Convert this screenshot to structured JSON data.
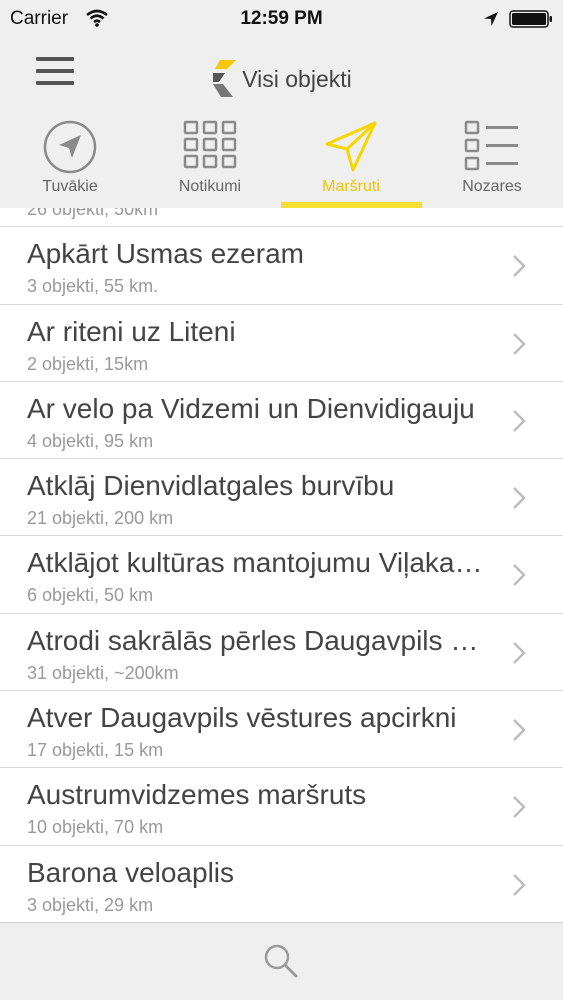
{
  "status_bar": {
    "carrier": "Carrier",
    "time": "12:59 PM",
    "wifi_icon": "wifi-icon",
    "location_icon": "location-arrow-icon",
    "battery_icon": "battery-full-icon"
  },
  "nav": {
    "title": "Visi objekti",
    "menu_icon": "hamburger-menu-icon",
    "logo_icon": "app-logo-icon"
  },
  "tabs": [
    {
      "label": "Tuvākie",
      "icon": "compass-arrow-icon",
      "active": false
    },
    {
      "label": "Notikumi",
      "icon": "grid-icon",
      "active": false
    },
    {
      "label": "Maršruti",
      "icon": "paper-plane-icon",
      "active": true
    },
    {
      "label": "Nozares",
      "icon": "list-icon",
      "active": false
    }
  ],
  "routes": {
    "partial_row_subtitle": "26 objekti, 50km",
    "items": [
      {
        "title": "Apkārt Usmas ezeram",
        "subtitle": "3 objekti, 55 km."
      },
      {
        "title": "Ar riteni uz Liteni",
        "subtitle": "2 objekti, 15km"
      },
      {
        "title": "Ar velo pa Vidzemi un Dienvidigauju",
        "subtitle": "4 objekti, 95 km"
      },
      {
        "title": "Atklāj Dienvidlatgales burvību",
        "subtitle": "21 objekti, 200 km"
      },
      {
        "title": "Atklājot kultūras mantojumu Viļakas novadā",
        "subtitle": "6 objekti, 50 km"
      },
      {
        "title": "Atrodi sakrālās pērles Daugavpils novadā",
        "subtitle": "31 objekti, ~200km"
      },
      {
        "title": "Atver Daugavpils vēstures apcirkni",
        "subtitle": "17 objekti, 15 km"
      },
      {
        "title": "Austrumvidzemes maršruts",
        "subtitle": "10 objekti, 70 km"
      },
      {
        "title": "Barona veloaplis",
        "subtitle": "3 objekti, 29 km"
      }
    ]
  },
  "bottom_bar": {
    "search_icon": "search-icon"
  },
  "colors": {
    "accent": "#f7de33",
    "accent_text": "#f0c400",
    "background": "#efeff0"
  }
}
